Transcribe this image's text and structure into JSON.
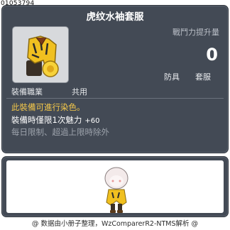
{
  "item": {
    "id": "01053794",
    "name": "虎纹水袖套服",
    "boost_label": "戰鬥力提升量",
    "boost_value": "0",
    "categories": [
      "防具",
      "套服"
    ],
    "job_label": "裝備職業",
    "job_value": "共用",
    "dye_note": "此裝備可進行染色。",
    "equip_effect": "裝備時僅限1次魅力",
    "equip_effect_bonus": "+60",
    "limit_note": "每日限制、超過上限時除外",
    "icon": "tiger-pattern-outfit-icon"
  },
  "footer": "@ 数据由小册子整理，WzComparerR2-NTMS解析 @",
  "colors": {
    "panel_bg": "#434a55",
    "title": "#ffffff",
    "dye_note": "#f4c84a",
    "limit_note": "#9ca2ab"
  }
}
